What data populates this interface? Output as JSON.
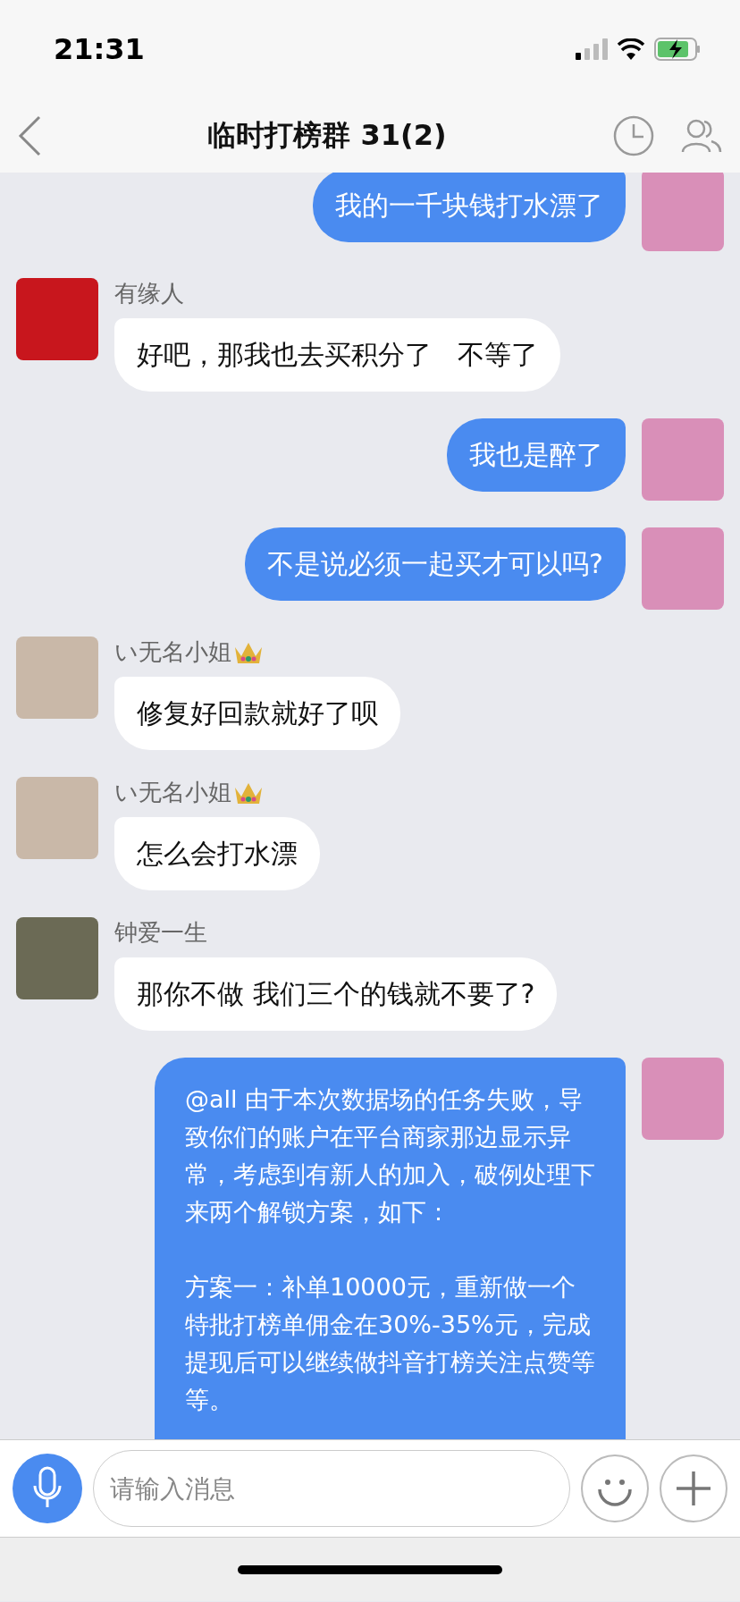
{
  "status_bar": {
    "time": "21:31"
  },
  "header": {
    "title": "临时打榜群 31(2)"
  },
  "messages": [
    {
      "kind": "outgoing",
      "text": "我的一千块钱打水漂了"
    },
    {
      "kind": "incoming",
      "sender": "有缘人",
      "crown": false,
      "color": "#c8161d",
      "text": "好吧，那我也去买积分了   不等了"
    },
    {
      "kind": "outgoing",
      "text": "我也是醉了"
    },
    {
      "kind": "outgoing",
      "text": "不是说必须一起买才可以吗?"
    },
    {
      "kind": "incoming",
      "sender": "い无名小姐",
      "crown": true,
      "color": "#c9b8a8",
      "text": "修复好回款就好了呗"
    },
    {
      "kind": "incoming",
      "sender": "い无名小姐",
      "crown": true,
      "color": "#c9b8a8",
      "text": "怎么会打水漂"
    },
    {
      "kind": "incoming",
      "sender": "钟爱一生",
      "crown": false,
      "color": "#6b6a55",
      "text": "那你不做 我们三个的钱就不要了?"
    },
    {
      "kind": "announcement",
      "paragraphs": [
        "@all 由于本次数据场的任务失败，导致你们的账户在平台商家那边显示异常，考虑到有新人的加入，破例处理下来两个解锁方案，如下：",
        "方案一：补单10000元，重新做一个特批打榜单佣金在30%-35%元，完成提现后可以继续做抖音打榜关注点赞等等。"
      ]
    }
  ],
  "input": {
    "placeholder": "请输入消息"
  }
}
